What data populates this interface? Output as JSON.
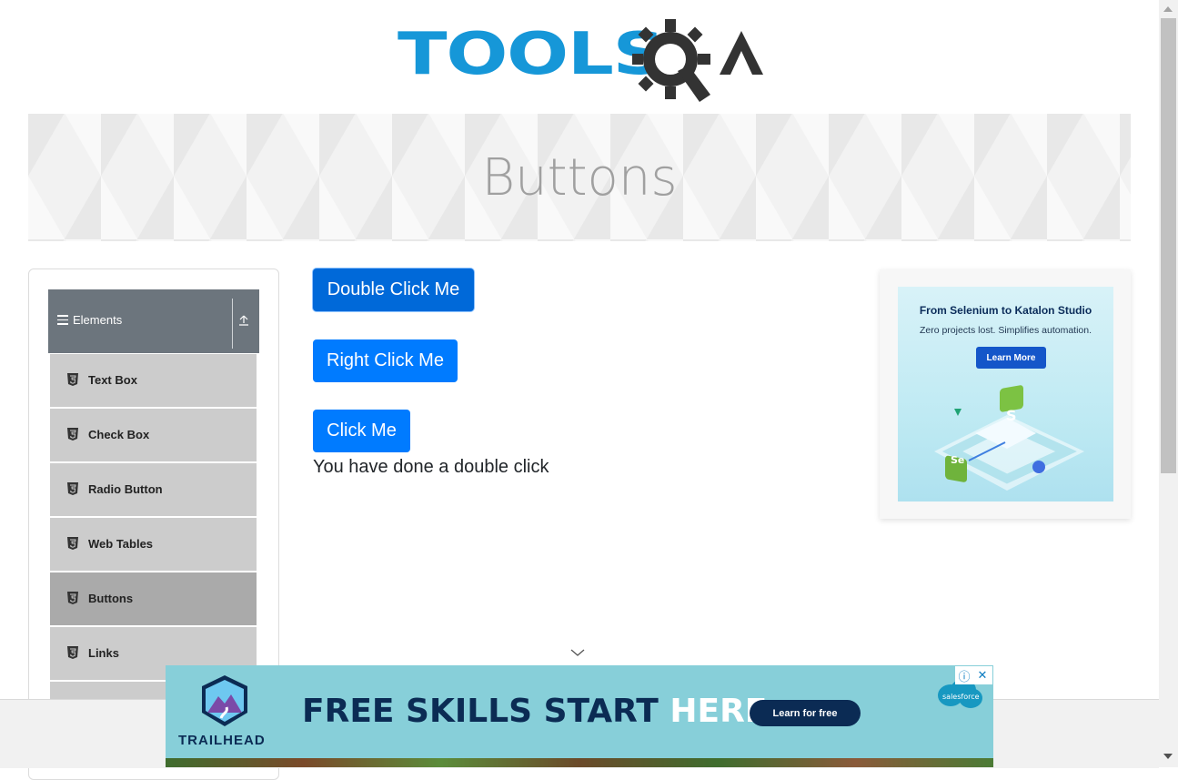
{
  "header": {
    "logo_tools": "TOOLS",
    "logo_suffix": "QA"
  },
  "banner": {
    "title": "Buttons"
  },
  "sidebar": {
    "group_title": "Elements",
    "items": [
      {
        "label": "Text Box",
        "active": false
      },
      {
        "label": "Check Box",
        "active": false
      },
      {
        "label": "Radio Button",
        "active": false
      },
      {
        "label": "Web Tables",
        "active": false
      },
      {
        "label": "Buttons",
        "active": true
      },
      {
        "label": "Links",
        "active": false
      }
    ]
  },
  "main": {
    "double_click_label": "Double Click Me",
    "right_click_label": "Right Click Me",
    "click_label": "Click Me",
    "result_message": "You have done a double click"
  },
  "ad_right": {
    "title": "From Selenium to Katalon Studio",
    "subtitle": "Zero projects lost. Simplifies automation.",
    "cta": "Learn More"
  },
  "ad_bottom": {
    "headline_dark": "FREE SKILLS START ",
    "headline_light": "HERE.",
    "cta": "Learn for free",
    "brand": "TRAILHEAD",
    "partner": "salesforce"
  },
  "colors": {
    "primary": "#007bff",
    "sidebar_header": "#6c757d",
    "menu_item": "#cccccc",
    "menu_item_active": "#aaaaaa",
    "logo_blue": "#1697d8"
  }
}
